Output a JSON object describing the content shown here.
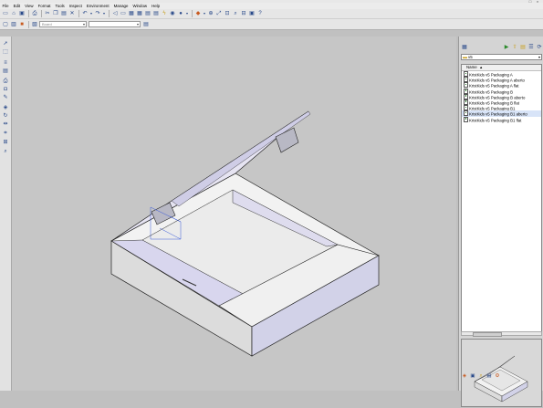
{
  "window": {
    "controls": [
      "_",
      "□",
      "×"
    ]
  },
  "menu": {
    "items": [
      "File",
      "Edit",
      "View",
      "Format",
      "Tools",
      "Inspect",
      "Environment",
      "Manage",
      "Window",
      "Help"
    ]
  },
  "toolbar2": {
    "layer_combo_value": "Board",
    "left_combo_value": "",
    "right_combo_value": ""
  },
  "file_browser": {
    "path": "v5",
    "column_header": "Name",
    "files": [
      "KristKids v5 Packaging A",
      "KristKids v5 Packaging A aberto",
      "KristKids v5 Packaging A flat",
      "KristKids v5 Packaging B",
      "KristKids v5 Packaging B aberto",
      "KristKids v5 Packaging B flat",
      "KristKids v5 Packaging B1",
      "KristKids v5 Packaging B1 aberto",
      "KristKids v5 Packaging B1 flat"
    ],
    "selected_index": 7
  },
  "colors": {
    "viewport_bg": "#c6c6c6",
    "box_white": "#f4f4f4",
    "box_lavender": "#d8d6ee",
    "selection_blue": "#3a5ad8"
  },
  "icons": {
    "left_tools": [
      "select-arrow-icon",
      "edit-node-icon",
      "line-icon",
      "rect-icon",
      "print-icon",
      "camera-icon",
      "pencil-icon",
      "paint-icon",
      "rotate-icon",
      "dimension-icon",
      "measure-icon",
      "grid-icon",
      "zoom-icon"
    ]
  }
}
